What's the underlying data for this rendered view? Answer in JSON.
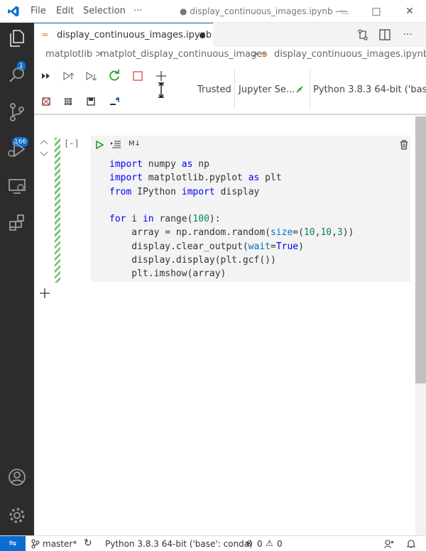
{
  "titlebar": {
    "menu": [
      "File",
      "Edit",
      "Selection",
      "···"
    ],
    "title": "● display_continuous_images.ipynb - ..."
  },
  "activity": {
    "scm_badge": "166",
    "explorer_badge": "1"
  },
  "tab": {
    "label": "display_continuous_images.ipynb"
  },
  "breadcrumb": [
    "matplotlib",
    ">",
    "matplot_display_continuous_images",
    ">",
    "display_continuous_images.ipynb"
  ],
  "toolbar": {
    "trusted": "Trusted",
    "server": "Jupyter Se...",
    "kernel": "Python 3.8.3 64-bit ('bas..."
  },
  "cell": {
    "exec_count": "[-]",
    "markdown_toggle": "M↓"
  },
  "statusbar": {
    "branch": "master*",
    "interpreter": "Python 3.8.3 64-bit ('base': conda)",
    "errors": "0",
    "warnings": "0"
  }
}
